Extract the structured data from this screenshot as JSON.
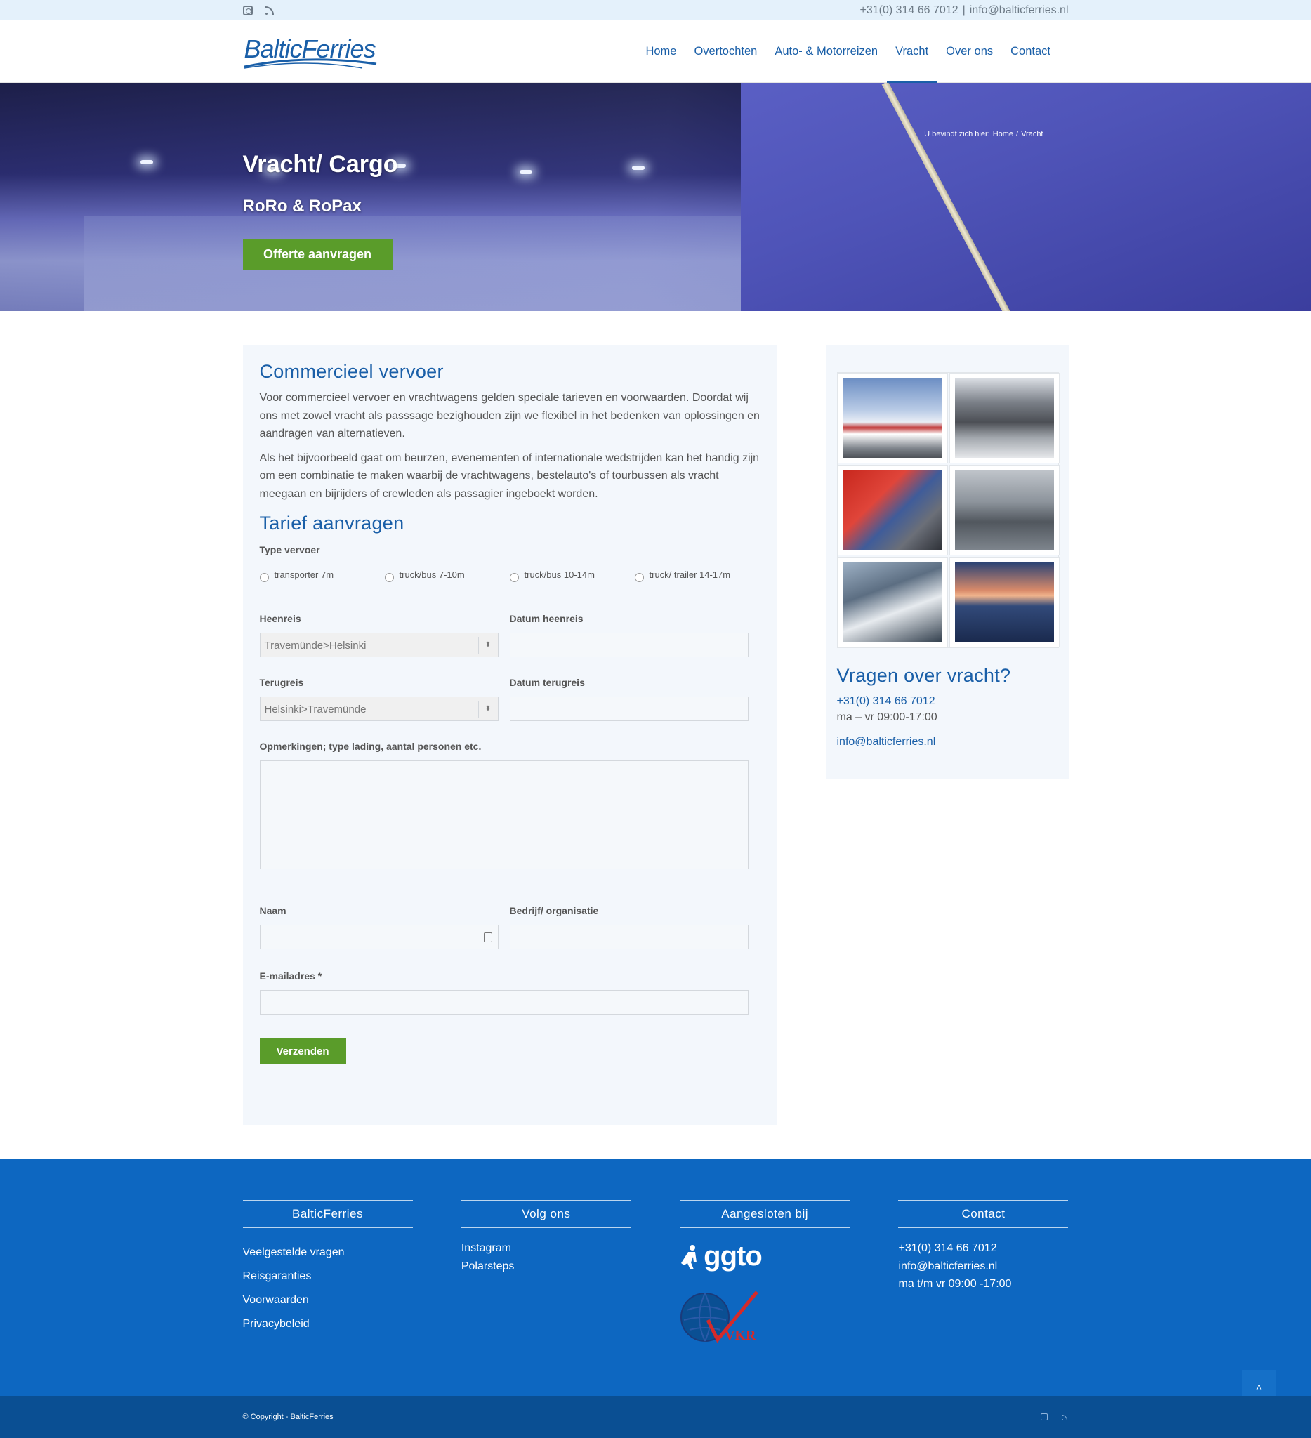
{
  "topbar": {
    "phone": "+31(0) 314 66 7012",
    "separator": "|",
    "email": "info@balticferries.nl"
  },
  "logo": {
    "text": "BalticFerries"
  },
  "nav": {
    "items": [
      {
        "label": "Home"
      },
      {
        "label": "Overtochten"
      },
      {
        "label": "Auto- & Motorreizen"
      },
      {
        "label": "Vracht",
        "active": true
      },
      {
        "label": "Over ons"
      },
      {
        "label": "Contact"
      }
    ]
  },
  "hero": {
    "breadcrumb_prefix": "U bevindt zich hier:",
    "breadcrumb_home": "Home",
    "breadcrumb_sep": "/",
    "breadcrumb_current": "Vracht",
    "title": "Vracht/ Cargo",
    "subtitle": "RoRo & RoPax",
    "button": "Offerte aanvragen"
  },
  "content": {
    "heading1": "Commercieel vervoer",
    "p1": "Voor commercieel vervoer en vrachtwagens gelden speciale tarieven en voorwaarden. Doordat wij ons met zowel vracht als passsage bezighouden zijn we flexibel in het bedenken van oplossingen en aandragen van alternatieven.",
    "p2": "Als het bijvoorbeeld gaat om beurzen, evenementen of internationale wedstrijden kan het handig zijn om een combinatie te maken waarbij de vrachtwagens, bestelauto's  of tourbussen als vracht meegaan en bijrijders of crewleden als passagier ingeboekt worden.",
    "heading2": "Tarief aanvragen"
  },
  "form": {
    "type_label": "Type vervoer",
    "radios": [
      "transporter 7m",
      "truck/bus 7-10m",
      "truck/bus 10-14m",
      "truck/ trailer 14-17m"
    ],
    "heenreis_label": "Heenreis",
    "heenreis_value": "Travemünde>Helsinki",
    "datum_heen_label": "Datum heenreis",
    "terugreis_label": "Terugreis",
    "terugreis_value": "Helsinki>Travemünde",
    "datum_terug_label": "Datum terugreis",
    "opmerkingen_label": "Opmerkingen; type lading, aantal personen etc.",
    "naam_label": "Naam",
    "bedrijf_label": "Bedrijf/ organisatie",
    "email_label": "E-mailadres *",
    "submit": "Verzenden"
  },
  "sidebar": {
    "heading": "Vragen over vracht?",
    "phone": "+31(0) 314 66 7012",
    "hours": "ma – vr 09:00-17:00",
    "email": "info@balticferries.nl"
  },
  "footer": {
    "col1": {
      "title": "BalticFerries",
      "links": [
        "Veelgestelde vragen",
        "Reisgaranties",
        "Voorwaarden",
        "Privacybeleid"
      ]
    },
    "col2": {
      "title": "Volg ons",
      "links": [
        "Instagram",
        "Polarsteps"
      ]
    },
    "col3": {
      "title": "Aangesloten bij",
      "ggto": "ggto"
    },
    "col4": {
      "title": "Contact",
      "lines": [
        "+31(0) 314 66 7012",
        "info@balticferries.nl",
        "ma t/m vr 09:00 -17:00"
      ]
    }
  },
  "bottombar": {
    "copyright": "© Copyright - BalticFerries"
  },
  "colors": {
    "brand_blue": "#1a5fa8",
    "button_green": "#5a9c2a",
    "footer_blue": "#0d67c1",
    "bottom_blue": "#0a4f93"
  }
}
